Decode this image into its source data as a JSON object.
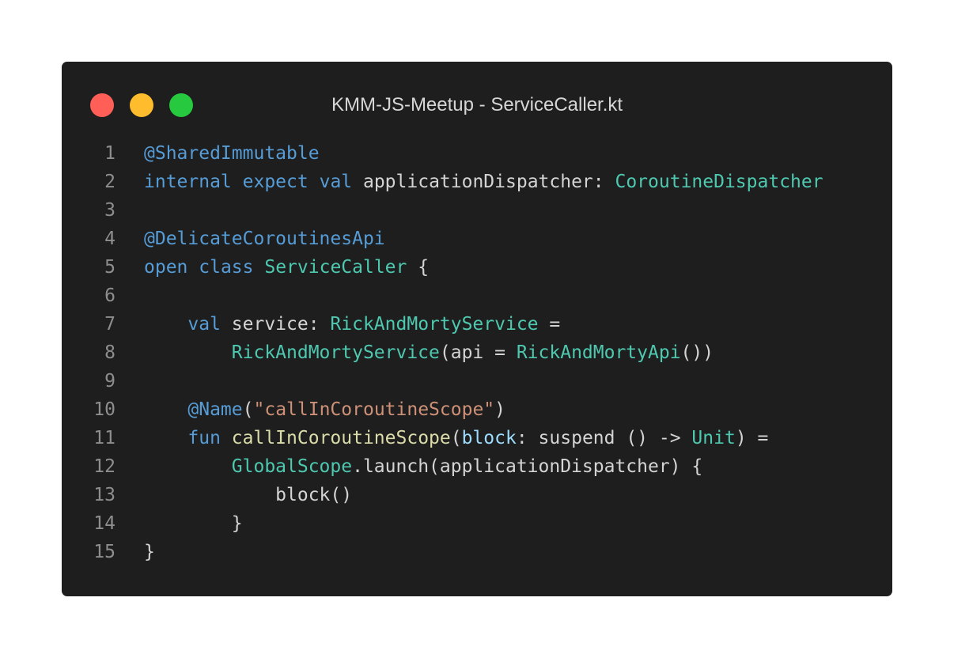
{
  "window": {
    "title": "KMM-JS-Meetup - ServiceCaller.kt",
    "buttons": {
      "close": "close-button",
      "minimize": "minimize-button",
      "maximize": "maximize-button"
    }
  },
  "colors": {
    "background": "#1e1e1e",
    "keyword": "#569cd6",
    "type": "#4ec9b0",
    "function": "#dcdcaa",
    "string": "#ce9178",
    "parameter": "#9cdcfe",
    "text": "#d4d4d4",
    "line_number": "#8e8e8e",
    "close": "#ff5f56",
    "minimize": "#ffbd2e",
    "maximize": "#27c93f"
  },
  "code": {
    "lines": [
      {
        "number": "1",
        "tokens": [
          {
            "t": "@SharedImmutable",
            "k": "ann"
          }
        ]
      },
      {
        "number": "2",
        "tokens": [
          {
            "t": "internal",
            "k": "kw"
          },
          {
            "t": " ",
            "k": "txt"
          },
          {
            "t": "expect",
            "k": "kw"
          },
          {
            "t": " ",
            "k": "txt"
          },
          {
            "t": "val",
            "k": "kw"
          },
          {
            "t": " applicationDispatcher: ",
            "k": "txt"
          },
          {
            "t": "CoroutineDispatcher",
            "k": "type"
          }
        ]
      },
      {
        "number": "3",
        "tokens": []
      },
      {
        "number": "4",
        "tokens": [
          {
            "t": "@DelicateCoroutinesApi",
            "k": "ann"
          }
        ]
      },
      {
        "number": "5",
        "tokens": [
          {
            "t": "open",
            "k": "kw"
          },
          {
            "t": " ",
            "k": "txt"
          },
          {
            "t": "class",
            "k": "kw"
          },
          {
            "t": " ",
            "k": "txt"
          },
          {
            "t": "ServiceCaller",
            "k": "type"
          },
          {
            "t": " {",
            "k": "txt"
          }
        ]
      },
      {
        "number": "6",
        "tokens": []
      },
      {
        "number": "7",
        "tokens": [
          {
            "t": "    ",
            "k": "txt"
          },
          {
            "t": "val",
            "k": "kw"
          },
          {
            "t": " service: ",
            "k": "txt"
          },
          {
            "t": "RickAndMortyService",
            "k": "type"
          },
          {
            "t": " =",
            "k": "txt"
          }
        ]
      },
      {
        "number": "8",
        "tokens": [
          {
            "t": "        ",
            "k": "txt"
          },
          {
            "t": "RickAndMortyService",
            "k": "type"
          },
          {
            "t": "(api = ",
            "k": "txt"
          },
          {
            "t": "RickAndMortyApi",
            "k": "type"
          },
          {
            "t": "())",
            "k": "txt"
          }
        ]
      },
      {
        "number": "9",
        "tokens": []
      },
      {
        "number": "10",
        "tokens": [
          {
            "t": "    ",
            "k": "txt"
          },
          {
            "t": "@Name",
            "k": "ann"
          },
          {
            "t": "(",
            "k": "txt"
          },
          {
            "t": "\"callInCoroutineScope\"",
            "k": "str"
          },
          {
            "t": ")",
            "k": "txt"
          }
        ]
      },
      {
        "number": "11",
        "tokens": [
          {
            "t": "    ",
            "k": "txt"
          },
          {
            "t": "fun",
            "k": "kw"
          },
          {
            "t": " ",
            "k": "txt"
          },
          {
            "t": "callInCoroutineScope",
            "k": "fn"
          },
          {
            "t": "(",
            "k": "txt"
          },
          {
            "t": "block",
            "k": "param"
          },
          {
            "t": ": suspend () -> ",
            "k": "txt"
          },
          {
            "t": "Unit",
            "k": "type"
          },
          {
            "t": ") =",
            "k": "txt"
          }
        ]
      },
      {
        "number": "12",
        "tokens": [
          {
            "t": "        ",
            "k": "txt"
          },
          {
            "t": "GlobalScope",
            "k": "type"
          },
          {
            "t": ".launch(applicationDispatcher) {",
            "k": "txt"
          }
        ]
      },
      {
        "number": "13",
        "tokens": [
          {
            "t": "            block()",
            "k": "txt"
          }
        ]
      },
      {
        "number": "14",
        "tokens": [
          {
            "t": "        }",
            "k": "txt"
          }
        ]
      },
      {
        "number": "15",
        "tokens": [
          {
            "t": "}",
            "k": "txt"
          }
        ]
      }
    ]
  }
}
